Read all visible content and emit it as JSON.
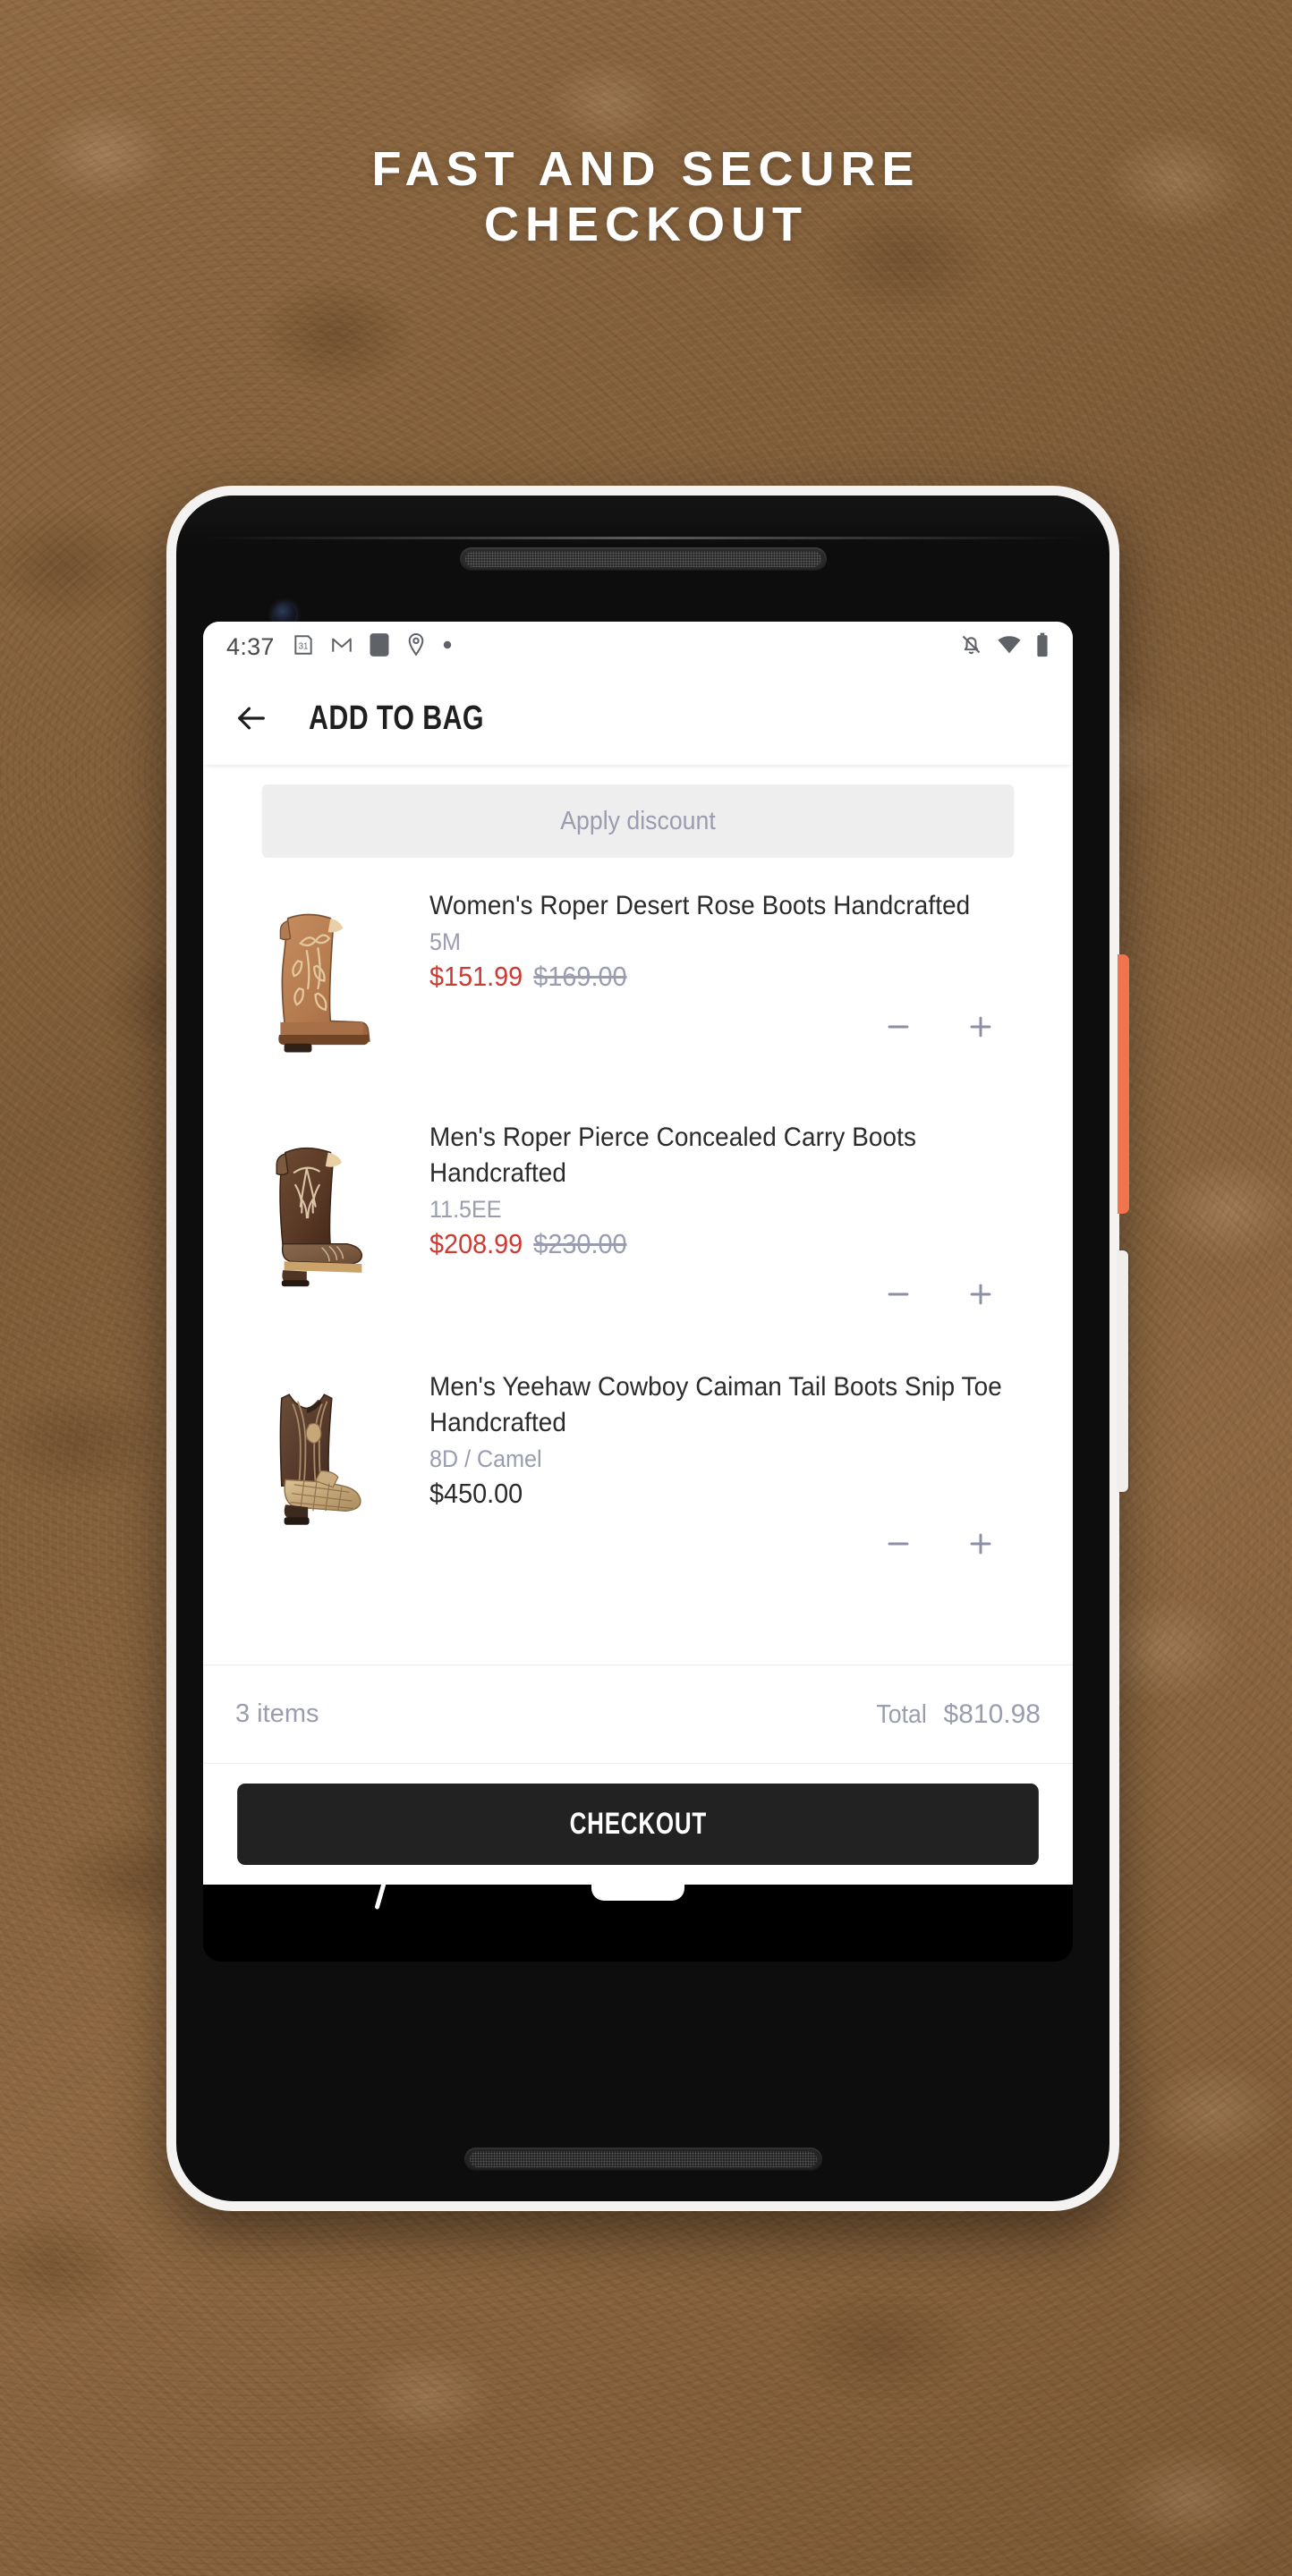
{
  "promo": {
    "headline_line1": "FAST AND SECURE",
    "headline_line2": "CHECKOUT"
  },
  "phone": {
    "hardware": {
      "power_button_color": "#f1744c",
      "volume_button_color": "#efeeeb",
      "frame_color": "#f4f3f1",
      "body_color": "#0d0d0d"
    }
  },
  "status_bar": {
    "time": "4:37",
    "left_icons": [
      "calendar-31-icon",
      "gmail-icon",
      "app-square-icon",
      "location-pin-icon",
      "dot-icon"
    ],
    "right_icons": [
      "notifications-off-icon",
      "wifi-icon",
      "battery-icon"
    ],
    "calendar_day": "31"
  },
  "app_bar": {
    "back_icon": "back-arrow-icon",
    "title": "ADD TO BAG"
  },
  "discount": {
    "placeholder": "Apply discount",
    "value": ""
  },
  "cart": {
    "items": [
      {
        "title": "Women's Roper Desert Rose  Boots Handcrafted",
        "variant": "5M",
        "price": "$151.99",
        "compare_at": "$169.00",
        "on_sale": true,
        "image": "tan-rose-embroidered-cowboy-boot",
        "decrease_label": "–",
        "increase_label": "+"
      },
      {
        "title": "Men's Roper Pierce Concealed Carry Boots Handcrafted",
        "variant": "11.5EE",
        "price": "$208.99",
        "compare_at": "$230.00",
        "on_sale": true,
        "image": "dark-brown-square-toe-cowboy-boot",
        "decrease_label": "–",
        "increase_label": "+"
      },
      {
        "title": "Men's Yeehaw Cowboy Caiman Tail Boots Snip Toe Handcrafted",
        "variant": "8D / Camel",
        "price": "$450.00",
        "compare_at": "",
        "on_sale": false,
        "image": "camel-caiman-tail-snip-toe-boot",
        "decrease_label": "–",
        "increase_label": "+"
      }
    ]
  },
  "totals": {
    "item_count_label": "3 items",
    "total_label": "Total",
    "total_amount": "$810.98"
  },
  "checkout": {
    "label": "CHECKOUT"
  },
  "colors": {
    "sale_price": "#cc3a33",
    "muted_text": "#9a9cb0",
    "primary_text": "#2b2b2b",
    "button_bg": "#222222",
    "field_bg": "#eeeeee",
    "background_leather": "#8a6540"
  }
}
